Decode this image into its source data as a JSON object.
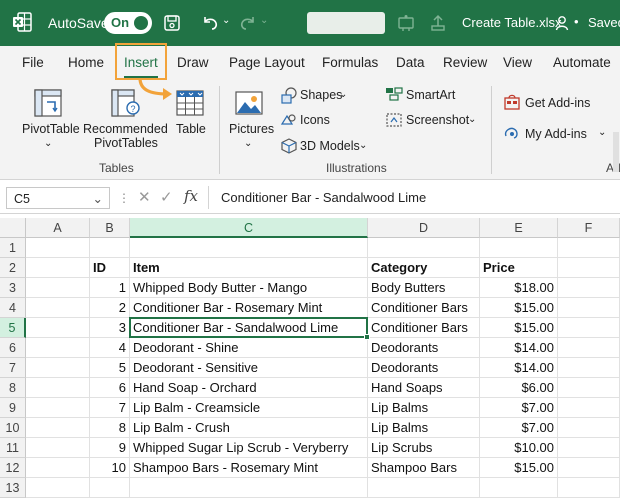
{
  "titlebar": {
    "autosave_label": "AutoSave",
    "toggle_state": "On",
    "filename": "Create Table.xlsx",
    "saved_label": "Saved"
  },
  "tabs": [
    "File",
    "Home",
    "Insert",
    "Draw",
    "Page Layout",
    "Formulas",
    "Data",
    "Review",
    "View",
    "Automate"
  ],
  "active_tab": "Insert",
  "ribbon": {
    "pivottable": "PivotTable",
    "recommended_line1": "Recommended",
    "recommended_line2": "PivotTables",
    "table": "Table",
    "tables_group": "Tables",
    "pictures": "Pictures",
    "shapes": "Shapes",
    "icons": "Icons",
    "models3d": "3D Models",
    "smartart": "SmartArt",
    "screenshot": "Screenshot",
    "illustrations_group": "Illustrations",
    "get_addins": "Get Add-ins",
    "my_addins": "My Add-ins",
    "addins_group_partial": "Ad"
  },
  "formula_bar": {
    "name_box": "C5",
    "formula": "Conditioner Bar - Sandalwood Lime"
  },
  "grid": {
    "columns": [
      "A",
      "B",
      "C",
      "D",
      "E",
      "F"
    ],
    "selected_column": "C",
    "rows": [
      "1",
      "2",
      "3",
      "4",
      "5",
      "6",
      "7",
      "8",
      "9",
      "10",
      "11",
      "12",
      "13"
    ],
    "selected_row": "5",
    "headers": {
      "id": "ID",
      "item": "Item",
      "category": "Category",
      "price": "Price"
    },
    "data": [
      {
        "id": "1",
        "item": "Whipped Body Butter - Mango",
        "category": "Body Butters",
        "price": "$18.00"
      },
      {
        "id": "2",
        "item": "Conditioner Bar - Rosemary Mint",
        "category": "Conditioner Bars",
        "price": "$15.00"
      },
      {
        "id": "3",
        "item": "Conditioner Bar - Sandalwood Lime",
        "category": "Conditioner Bars",
        "price": "$15.00"
      },
      {
        "id": "4",
        "item": "Deodorant - Shine",
        "category": "Deodorants",
        "price": "$14.00"
      },
      {
        "id": "5",
        "item": "Deodorant - Sensitive",
        "category": "Deodorants",
        "price": "$14.00"
      },
      {
        "id": "6",
        "item": "Hand Soap - Orchard",
        "category": "Hand Soaps",
        "price": "$6.00"
      },
      {
        "id": "7",
        "item": "Lip Balm - Creamsicle",
        "category": "Lip Balms",
        "price": "$7.00"
      },
      {
        "id": "8",
        "item": "Lip Balm - Crush",
        "category": "Lip Balms",
        "price": "$7.00"
      },
      {
        "id": "9",
        "item": "Whipped Sugar Lip Scrub - Veryberry",
        "category": "Lip Scrubs",
        "price": "$10.00"
      },
      {
        "id": "10",
        "item": "Shampoo Bars - Rosemary Mint",
        "category": "Shampoo Bars",
        "price": "$15.00"
      }
    ]
  },
  "colors": {
    "excel_green": "#217346",
    "highlight_orange": "#f2a33a"
  }
}
